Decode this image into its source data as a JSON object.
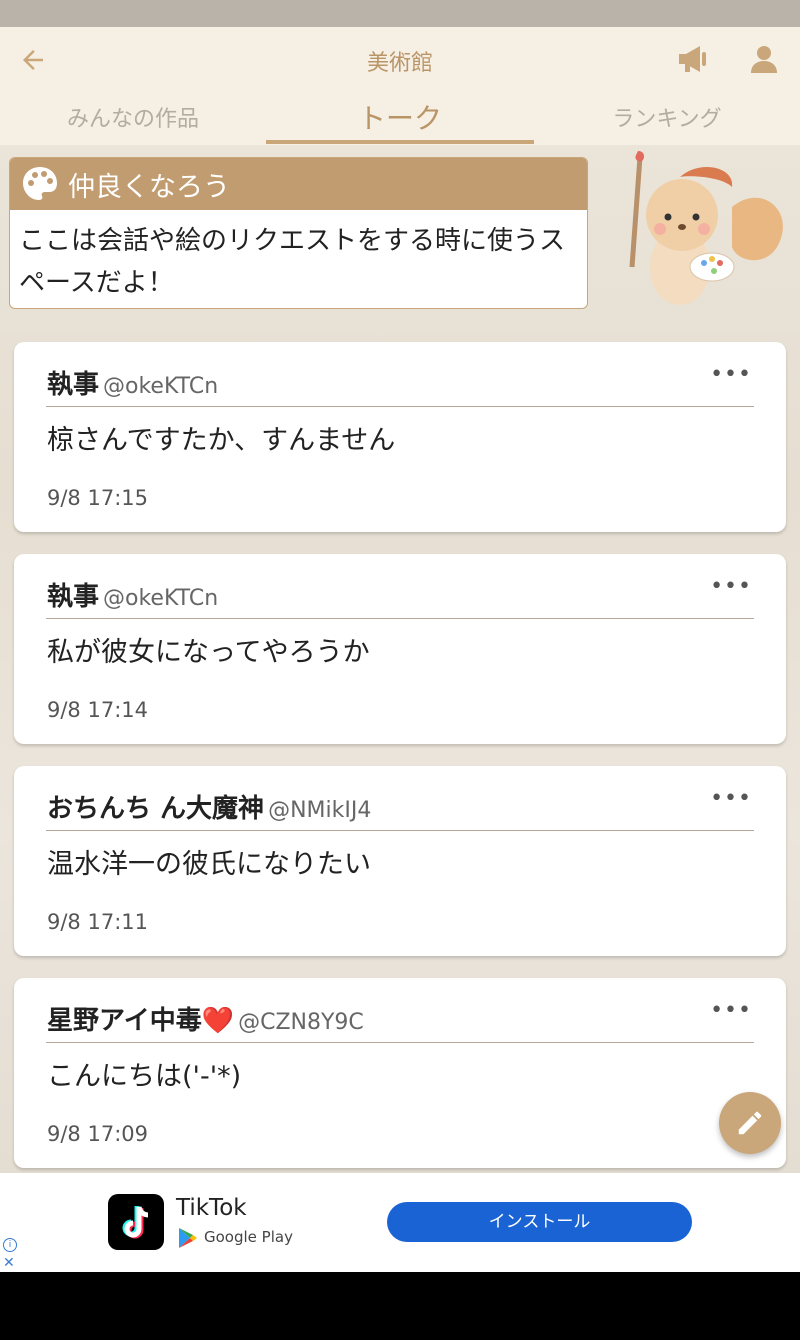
{
  "colors": {
    "accent": "#c9a77a",
    "header_bg": "#f6efe4",
    "install_button": "#1a63d4"
  },
  "header": {
    "title": "美術館",
    "back_icon": "arrow-left-icon",
    "announce_icon": "megaphone-icon",
    "profile_icon": "person-icon"
  },
  "tabs": [
    {
      "label": "みんなの作品",
      "active": false
    },
    {
      "label": "トーク",
      "active": true
    },
    {
      "label": "ランキング",
      "active": false
    }
  ],
  "info": {
    "title": "仲良くなろう",
    "icon": "palette-icon",
    "body": "ここは会話や絵のリクエストをする時に使うスペースだよ！"
  },
  "posts": [
    {
      "name": "執事",
      "handle": "@okeKTCn",
      "text": "椋さんですたか、すんません",
      "time": "9/8 17:15",
      "more": "•••"
    },
    {
      "name": "執事",
      "handle": "@okeKTCn",
      "text": "私が彼女になってやろうか",
      "time": "9/8 17:14",
      "more": "•••"
    },
    {
      "name": "おちんち ん大魔神",
      "handle": "@NMikIJ4",
      "text": "温水洋一の彼氏になりたい",
      "time": "9/8 17:11",
      "more": "•••"
    },
    {
      "name": "星野アイ中毒❤️",
      "handle": "@CZN8Y9C",
      "text": "こんにちは('-'*)",
      "time": "9/8 17:09",
      "more": "•••"
    }
  ],
  "fab_icon": "pencil-icon",
  "ad": {
    "app_name": "TikTok",
    "store": "Google Play",
    "install_label": "インストール",
    "info_mark": "i",
    "close_mark": "✕"
  }
}
